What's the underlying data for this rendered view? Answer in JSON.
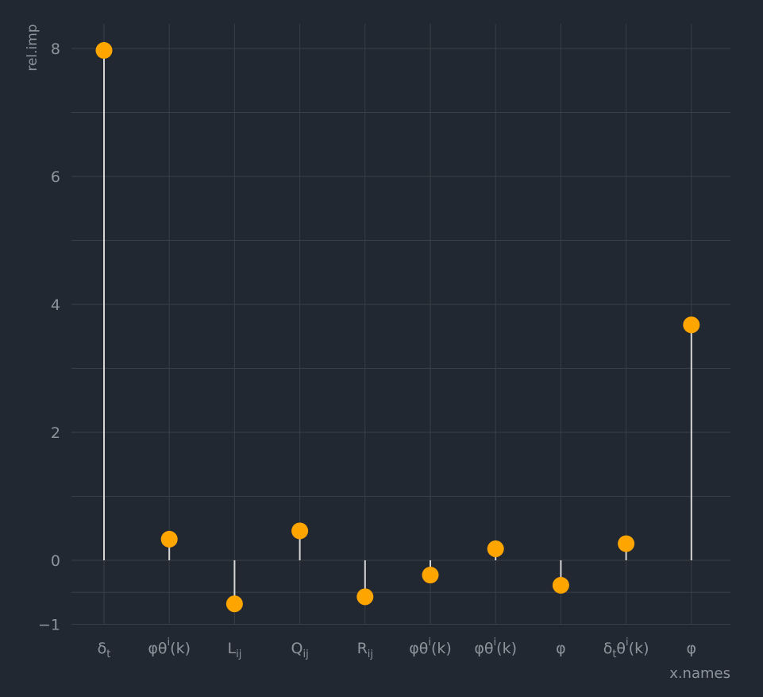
{
  "chart_data": {
    "type": "lollipop",
    "xlabel": "x.names",
    "ylabel": "rel.imp",
    "ylim": [
      -1,
      8.4
    ],
    "y_ticks": [
      -1,
      0,
      2,
      4,
      6,
      8
    ],
    "grid": true,
    "categories": [
      {
        "base": "δ",
        "sub": "t",
        "sup": "",
        "tail": ""
      },
      {
        "base": "φθ",
        "sub": "",
        "sup": "i",
        "tail": "(k)"
      },
      {
        "base": "L",
        "sub": "ij",
        "sup": "",
        "tail": ""
      },
      {
        "base": "Q",
        "sub": "ij",
        "sup": "",
        "tail": ""
      },
      {
        "base": "R",
        "sub": "ij",
        "sup": "",
        "tail": ""
      },
      {
        "base": "φθ",
        "sub": "",
        "sup": "i",
        "tail": "(k)"
      },
      {
        "base": "φθ",
        "sub": "",
        "sup": "i",
        "tail": "(k)"
      },
      {
        "base": "φ",
        "sub": "",
        "sup": "",
        "tail": ""
      },
      {
        "base": "δ",
        "sub": "t",
        "sup": "",
        "tail": "θ",
        "sup2": "i",
        "tail2": "(k)"
      },
      {
        "base": "φ",
        "sub": "",
        "sup": "",
        "tail": ""
      }
    ],
    "values": [
      7.97,
      0.33,
      -0.68,
      0.46,
      -0.57,
      -0.23,
      0.18,
      -0.39,
      0.26,
      3.68
    ],
    "colors": {
      "background": "#222831",
      "grid": "#393f48",
      "point": "#ffa500",
      "stem": "#d6d6d6",
      "text": "#8e949c"
    }
  }
}
